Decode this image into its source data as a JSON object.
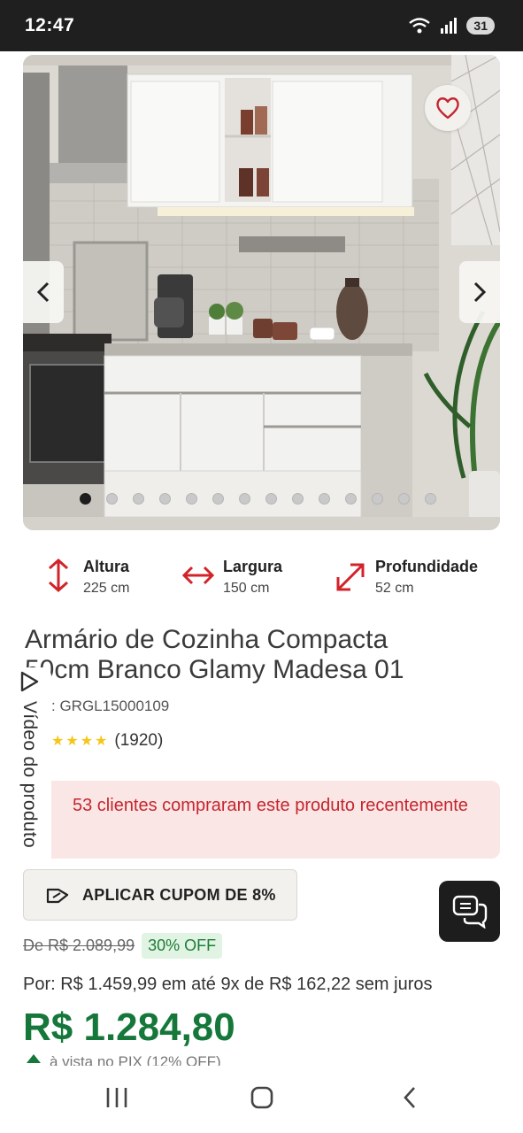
{
  "status_bar": {
    "time": "12:47",
    "battery": "31",
    "icons": [
      "wifi-icon",
      "signal-icon",
      "battery-icon"
    ]
  },
  "gallery": {
    "image_subject": "white compact kitchen cabinet",
    "slide_count": 14,
    "active_slide": 1,
    "favorite_icon": "heart-icon",
    "prev_icon": "chevron-left-icon",
    "next_icon": "chevron-right-icon"
  },
  "dimensions": [
    {
      "label": "Altura",
      "value": "225 cm",
      "icon": "arrow-vertical-icon"
    },
    {
      "label": "Largura",
      "value": "150 cm",
      "icon": "arrow-horizontal-icon"
    },
    {
      "label": "Profundidade",
      "value": "52 cm",
      "icon": "arrow-diagonal-icon"
    }
  ],
  "product": {
    "title_line1": "Armário de Cozinha Compacta",
    "title_line2": "50cm Branco Glamy Madesa 01",
    "sku": ": GRGL15000109",
    "stars": "★★★★",
    "rating_count": "(1920)"
  },
  "video_tab": {
    "label": "Vídeo do produto",
    "icon": "play-icon"
  },
  "alert": {
    "text": "53 clientes compraram este produto recentemente"
  },
  "coupon": {
    "label": "APLICAR CUPOM DE 8%",
    "icon": "coupon-icon"
  },
  "pricing": {
    "old_price": "De R$ 2.089,99",
    "discount": "30% OFF",
    "installment": "Por: R$ 1.459,99 em até 9x de R$ 162,22 sem juros",
    "price": "R$ 1.284,80",
    "pix_note": "à vista no PIX (12% OFF)"
  },
  "chat": {
    "icon": "chat-icon"
  },
  "nav_bar": {
    "recent_icon": "recent-apps-icon",
    "home_icon": "home-icon",
    "back_icon": "back-icon"
  },
  "colors": {
    "brand_green": "#15783a",
    "alert_red": "#c4262e",
    "alert_bg": "#fbe6e6",
    "discount_bg": "#e1f3e2"
  }
}
